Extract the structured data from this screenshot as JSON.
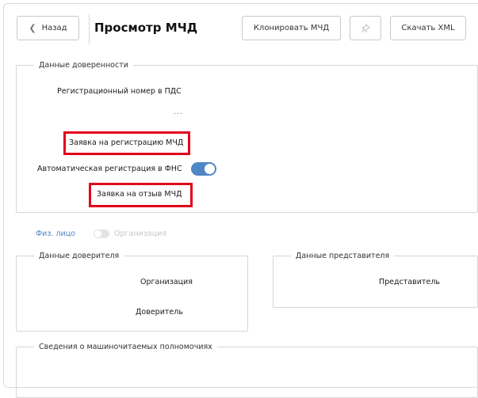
{
  "header": {
    "back_label": "Назад",
    "title": "Просмотр МЧД",
    "clone_label": "Клонировать МЧД",
    "pin_icon": "pin-icon",
    "download_label": "Скачать XML"
  },
  "trust_data": {
    "legend": "Данные доверенности",
    "reg_number_label": "Регистрационный номер в ПДС",
    "reg_number_value": "...",
    "request_registration_label": "Заявка на регистрацию МЧД",
    "auto_reg_label": "Автоматическая регистрация в ФНС",
    "auto_reg_enabled": true,
    "request_revoke_label": "Заявка на отзыв МЧД"
  },
  "person_type": {
    "left_label": "Физ. лицо",
    "right_label": "Организация",
    "is_organization": false
  },
  "principal": {
    "legend": "Данные доверителя",
    "org_label": "Организация",
    "principal_label": "Доверитель"
  },
  "representative": {
    "legend": "Данные представителя",
    "rep_label": "Представитель"
  },
  "powers": {
    "legend": "Сведения о машиночитаемых полномочиях"
  },
  "colors": {
    "highlight": "#e3001b",
    "toggle_accent": "#4f86c6"
  }
}
